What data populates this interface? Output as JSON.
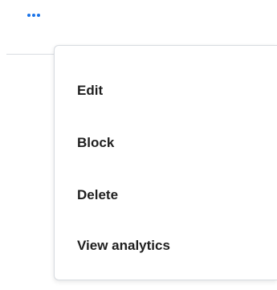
{
  "more_button": {
    "icon": "more-horizontal-icon",
    "color": "#1a73e8"
  },
  "menu": {
    "items": [
      {
        "label": "Edit"
      },
      {
        "label": "Block"
      },
      {
        "label": "Delete"
      },
      {
        "label": "View analytics"
      }
    ]
  }
}
